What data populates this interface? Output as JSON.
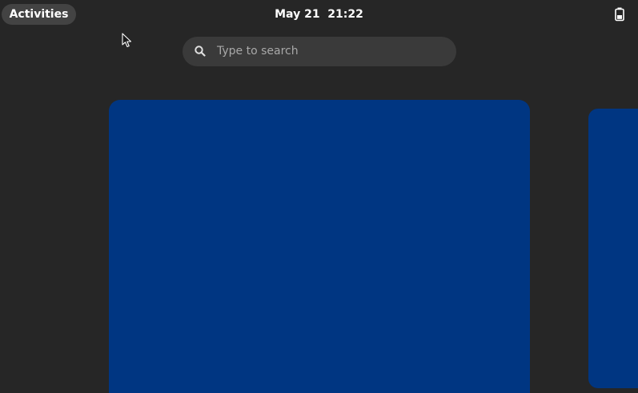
{
  "top_bar": {
    "activities_label": "Activities",
    "clock": "May 21  21:22",
    "battery_icon": "battery-icon"
  },
  "search": {
    "placeholder": "Type to search",
    "icon": "search-icon"
  },
  "workspaces": {
    "color": "#003682"
  },
  "colors": {
    "background": "#262626",
    "pill": "#434343",
    "search_bg": "#3a3a3a",
    "placeholder": "#a8a8a8"
  },
  "cursor": "mouse-pointer-icon"
}
